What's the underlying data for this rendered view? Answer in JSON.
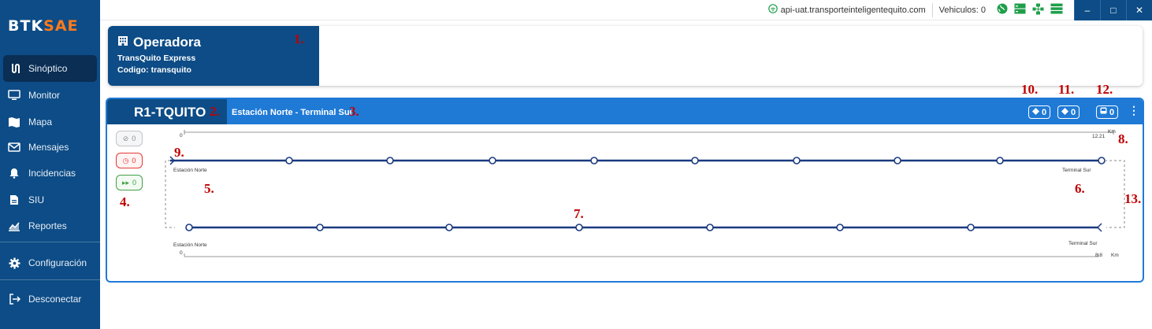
{
  "sidebar": {
    "logo_main": "BTK",
    "logo_accent": "SAE",
    "items": [
      {
        "label": "Sinóptico"
      },
      {
        "label": "Monitor"
      },
      {
        "label": "Mapa"
      },
      {
        "label": "Mensajes"
      },
      {
        "label": "Incidencias"
      },
      {
        "label": "SIU"
      },
      {
        "label": "Reportes"
      },
      {
        "label": "Configuración"
      },
      {
        "label": "Desconectar"
      }
    ]
  },
  "topbar": {
    "api": "api-uat.transporteinteligentequito.com",
    "vehicles": "Vehiculos: 0",
    "win_min": "–",
    "win_max": "□",
    "win_close": "✕"
  },
  "operator": {
    "title": "Operadora",
    "name": "TransQuito Express",
    "code": "Codigo: transquito"
  },
  "route": {
    "code": "R1-TQUITO",
    "name": "Estación Norte - Terminal Sur",
    "count_a": "0",
    "count_b": "0",
    "count_bus": "0",
    "status_gray": "0",
    "status_red": "0",
    "status_green": "0",
    "top_start": "0",
    "top_end": "12.21",
    "top_unit": "Km",
    "bottom_start": "0",
    "bottom_end": "8.8",
    "bottom_unit": "Km",
    "top_origin": "Estación Norte",
    "top_dest": "Terminal Sur",
    "bottom_origin": "Estación Norte",
    "bottom_dest": "Terminal Sur"
  },
  "annotations": [
    "1.",
    "2.",
    "3.",
    "4.",
    "5.",
    "6.",
    "7.",
    "8.",
    "9.",
    "10.",
    "11.",
    "12.",
    "13."
  ],
  "colors": {
    "brand": "#0d4c86",
    "header_blue": "#1f7ad6",
    "accent": "#ff7a1a",
    "annotation": "#c00000"
  }
}
